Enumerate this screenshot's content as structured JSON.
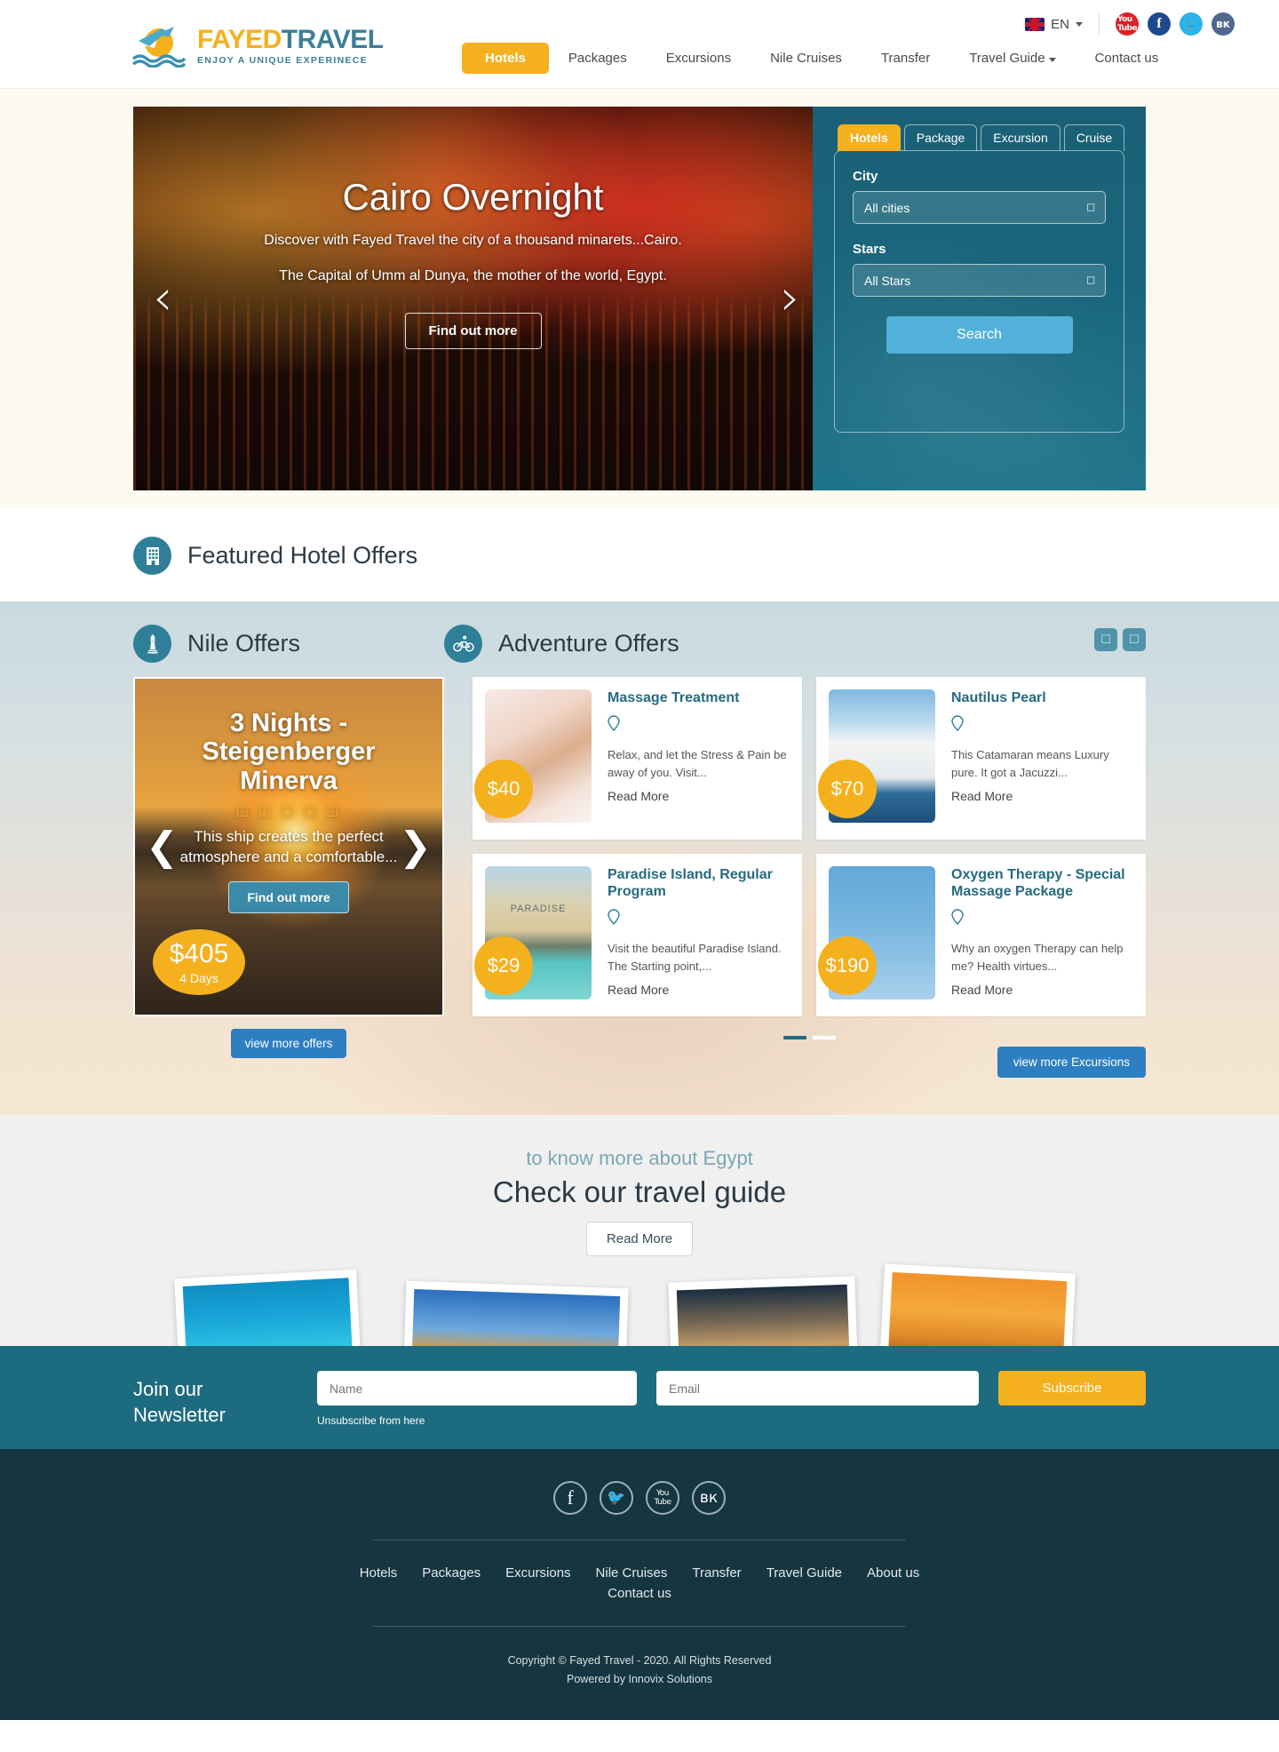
{
  "header": {
    "logo": {
      "part_a": "FAYED",
      "part_b": "TRAVEL",
      "tagline": "ENJOY A UNIQUE EXPERINECE"
    },
    "language": {
      "code": "EN",
      "flag_icon": "uk-flag-icon"
    },
    "socials": [
      {
        "name": "youtube",
        "glyph": "You\nTube"
      },
      {
        "name": "facebook",
        "glyph": "f"
      },
      {
        "name": "twitter",
        "glyph": "ὂ6"
      },
      {
        "name": "vk",
        "glyph": "вк"
      }
    ],
    "nav": [
      {
        "label": "Hotels",
        "active": true
      },
      {
        "label": "Packages",
        "active": false
      },
      {
        "label": "Excursions",
        "active": false
      },
      {
        "label": "Nile Cruises",
        "active": false
      },
      {
        "label": "Transfer",
        "active": false
      },
      {
        "label": "Travel Guide",
        "active": false,
        "has_caret": true
      },
      {
        "label": "Contact us",
        "active": false
      }
    ]
  },
  "hero": {
    "title": "Cairo Overnight",
    "line1": "Discover with Fayed Travel the city of a thousand minarets...Cairo.",
    "line2": "The Capital of Umm al Dunya, the mother of the world, Egypt.",
    "cta": "Find out more",
    "prev_icon": "chevron-left-icon",
    "next_icon": "chevron-right-icon"
  },
  "search": {
    "tabs": [
      {
        "label": "Hotels",
        "active": true
      },
      {
        "label": "Package",
        "active": false
      },
      {
        "label": "Excursion",
        "active": false
      },
      {
        "label": "Cruise",
        "active": false
      }
    ],
    "city_label": "City",
    "city_value": "All cities",
    "stars_label": "Stars",
    "stars_value": "All Stars",
    "button": "Search"
  },
  "featured": {
    "title": "Featured Hotel Offers",
    "icon": "building-icon"
  },
  "nile": {
    "section_title": "Nile Offers",
    "section_icon": "lighthouse-icon",
    "card": {
      "title": "3 Nights - Steigenberger Minerva",
      "stars": "☐ ☐ ☐ ☐ ☐",
      "desc": "This ship creates the perfect atmosphere and a comfortable...",
      "cta": "Find out more",
      "price": "$405",
      "duration": "4 Days"
    },
    "view_more": "view more offers"
  },
  "adventure": {
    "section_title": "Adventure Offers",
    "section_icon": "bicycle-icon",
    "nav_prev_icon": "chevron-left-icon",
    "nav_next_icon": "chevron-right-icon",
    "cards": [
      {
        "title": "Massage Treatment",
        "price": "$40",
        "desc": "Relax, and let the Stress & Pain be away of you. Visit...",
        "read_more": "Read More",
        "pin_icon": "location-pin-icon",
        "thumb": "t1",
        "thumb_label": ""
      },
      {
        "title": "Nautilus Pearl",
        "price": "$70",
        "desc": "This Catamaran means Luxury pure. It got a Jacuzzi...",
        "read_more": "Read More",
        "pin_icon": "location-pin-icon",
        "thumb": "t2",
        "thumb_label": ""
      },
      {
        "title": "Paradise Island, Regular Program",
        "price": "$29",
        "desc": "Visit the beautiful Paradise Island. The Starting point,...",
        "read_more": "Read More",
        "pin_icon": "location-pin-icon",
        "thumb": "t3",
        "thumb_label": "PARADISE"
      },
      {
        "title": "Oxygen Therapy - Special Massage Package",
        "price": "$190",
        "desc": "Why an oxygen Therapy can help me? Health virtues...",
        "read_more": "Read More",
        "pin_icon": "location-pin-icon",
        "thumb": "t4",
        "thumb_label": ""
      }
    ],
    "view_more": "view more Excursions"
  },
  "guide": {
    "kicker": "to know more about Egypt",
    "title": "Check our travel guide",
    "button": "Read More"
  },
  "newsletter": {
    "title": "Join our Newsletter",
    "name_placeholder": "Name",
    "email_placeholder": "Email",
    "button": "Subscribe",
    "unsubscribe": "Unsubscribe from here"
  },
  "footer": {
    "socials": [
      {
        "name": "facebook",
        "glyph": "f"
      },
      {
        "name": "twitter",
        "glyph": "ὂ6"
      },
      {
        "name": "youtube",
        "glyph": "You\nTube"
      },
      {
        "name": "vk",
        "glyph": "вк"
      }
    ],
    "links": [
      "Hotels",
      "Packages",
      "Excursions",
      "Nile Cruises",
      "Transfer",
      "Travel Guide",
      "About us",
      "Contact us"
    ],
    "copyright": "Copyright © Fayed Travel - 2020. All Rights Reserved",
    "powered": "Powered by Innovix Solutions"
  },
  "colors": {
    "accent_yellow": "#f5b01e",
    "teal": "#1d6b7e",
    "dark_teal": "#153540",
    "blue_button": "#2d7fc1",
    "search_blue": "#52b2db"
  }
}
